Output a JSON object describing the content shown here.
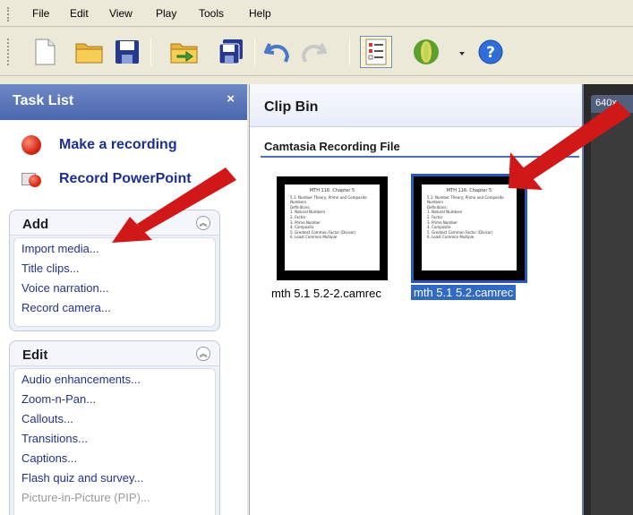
{
  "menu": {
    "file": "File",
    "edit": "Edit",
    "view": "View",
    "play": "Play",
    "tools": "Tools",
    "help": "Help"
  },
  "toolbar": {
    "icons": [
      "new-project-icon",
      "open-project-icon",
      "save-icon",
      "open-folder-icon",
      "save-all-icon",
      "undo-icon",
      "redo-icon",
      "task-list-icon",
      "produce-icon",
      "help-icon"
    ]
  },
  "task_list": {
    "title": "Task List",
    "close": "×",
    "make_recording": "Make a recording",
    "record_powerpoint": "Record PowerPoint",
    "add": {
      "title": "Add",
      "items": [
        "Import media...",
        "Title clips...",
        "Voice narration...",
        "Record camera..."
      ]
    },
    "edit": {
      "title": "Edit",
      "items": [
        "Audio enhancements...",
        "Zoom-n-Pan...",
        "Callouts...",
        "Transitions...",
        "Captions...",
        "Flash quiz and survey...",
        "Picture-in-Picture (PIP)..."
      ]
    }
  },
  "clip_bin": {
    "title": "Clip Bin",
    "section": "Camtasia Recording File",
    "clips": [
      {
        "label": "mth 5.1 5.2-2.camrec",
        "selected": false
      },
      {
        "label": "mth 5.1 5.2.camrec",
        "selected": true
      }
    ],
    "thumb_text": {
      "title": "MTH 116: Chapter 5",
      "lines": [
        "5.1: Number Theory; Prime and Composite",
        "Numbers",
        "Definitions:",
        "1. Natural Numbers",
        "2. Factor",
        "3. Prime Number",
        "4. Composite",
        "5. Greatest Common Factor (Divisor)",
        "6. Least Common Multiple"
      ]
    }
  },
  "preview": {
    "size_tab": "640x"
  },
  "colors": {
    "accent": "#4b67ad",
    "link": "#1d2f8f",
    "arrow": "#d01818",
    "selection": "#316ac5"
  }
}
